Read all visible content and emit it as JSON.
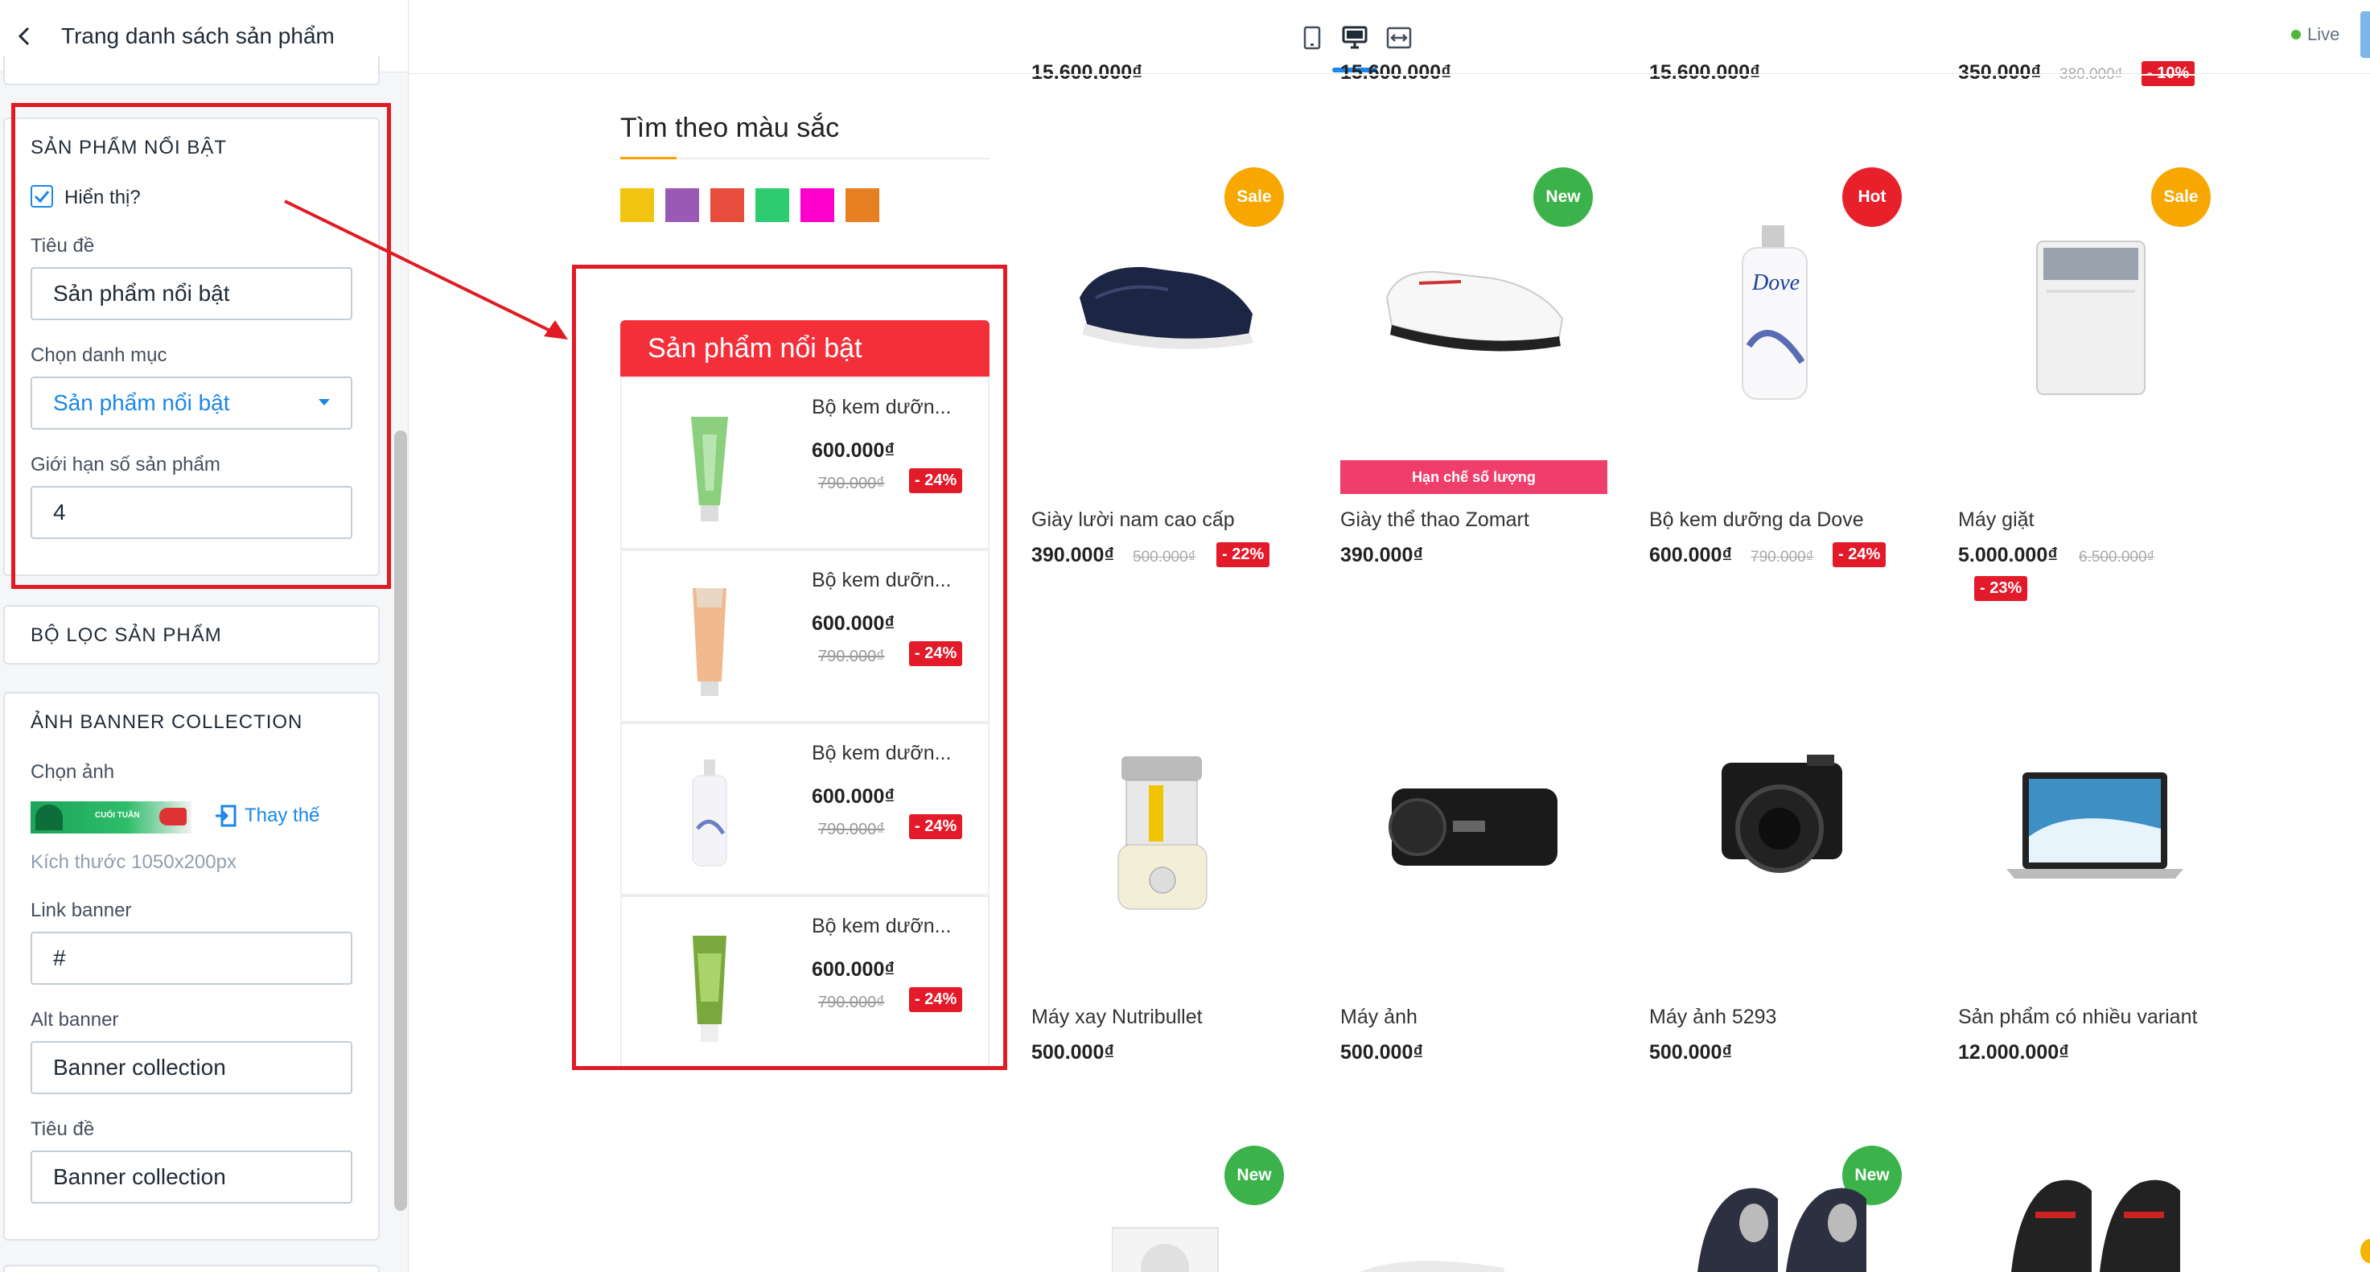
{
  "sidebar": {
    "header_title": "Trang danh sách sản phẩm",
    "featured": {
      "title": "SẢN PHẨM NỔI BẬT",
      "show_label": "Hiển thị?",
      "show_checked": true,
      "title_label": "Tiêu đề",
      "title_value": "Sản phẩm nổi bật",
      "category_label": "Chọn danh mục",
      "category_value": "Sản phẩm nổi bật",
      "limit_label": "Giới hạn số sản phẩm",
      "limit_value": "4"
    },
    "filter_title": "BỘ LỌC SẢN PHẨM",
    "banner": {
      "title": "ẢNH BANNER COLLECTION",
      "choose_label": "Chọn ảnh",
      "thumb_text": "CUỐI TUẦN",
      "replace_label": "Thay thế",
      "size_hint": "Kích thước 1050x200px",
      "link_label": "Link banner",
      "link_value": "#",
      "alt_label": "Alt banner",
      "alt_value": "Banner collection",
      "title_label": "Tiêu đề",
      "title_value": "Banner collection"
    }
  },
  "topbar": {
    "live_label": "Live",
    "active_device": "desktop"
  },
  "colors": {
    "title": "Tìm theo màu sắc",
    "swatches": [
      "#f1c40f",
      "#9b59b6",
      "#e74c3c",
      "#2ecc71",
      "#ff00cc",
      "#e67e22"
    ]
  },
  "featured_block": {
    "header": "Sản phẩm nổi bật",
    "items": [
      {
        "name": "Bộ kem dưỡn...",
        "price": "600.000₫",
        "old_price": "790.000₫",
        "discount": "- 24%"
      },
      {
        "name": "Bộ kem dưỡn...",
        "price": "600.000₫",
        "old_price": "790.000₫",
        "discount": "- 24%"
      },
      {
        "name": "Bộ kem dưỡn...",
        "price": "600.000₫",
        "old_price": "790.000₫",
        "discount": "- 24%"
      },
      {
        "name": "Bộ kem dưỡn...",
        "price": "600.000₫",
        "old_price": "790.000₫",
        "discount": "- 24%"
      }
    ]
  },
  "top_row_prices": [
    "15.600.000₫",
    "15.600.000₫",
    "15.600.000₫",
    "350.000₫"
  ],
  "top_row_old": "380.000₫",
  "top_row_badge": "- 10%",
  "products": [
    {
      "name": "Giày lười nam cao cấp",
      "price": "390.000₫",
      "old_price": "500.000₫",
      "discount": "- 22%",
      "ribbon": "Sale"
    },
    {
      "name": "Giày thể thao Zomart",
      "price": "390.000₫",
      "ribbon": "New",
      "limited": "Hạn chế số lượng"
    },
    {
      "name": "Bộ kem dưỡng da Dove",
      "price": "600.000₫",
      "old_price": "790.000₫",
      "discount": "- 24%",
      "ribbon": "Hot"
    },
    {
      "name": "Máy giặt",
      "price": "5.000.000₫",
      "old_price": "6.500.000₫",
      "discount": "- 23%",
      "ribbon": "Sale"
    },
    {
      "name": "Máy xay Nutribullet",
      "price": "500.000₫"
    },
    {
      "name": "Máy ảnh",
      "price": "500.000₫"
    },
    {
      "name": "Máy ảnh 5293",
      "price": "500.000₫"
    },
    {
      "name": "Sản phẩm có nhiều variant",
      "price": "12.000.000₫"
    }
  ],
  "bottom_ribbons": [
    "New",
    "New"
  ],
  "ribbon_colors": {
    "Sale": "#f7a700",
    "New": "#3bb34a",
    "Hot": "#e8202a"
  }
}
